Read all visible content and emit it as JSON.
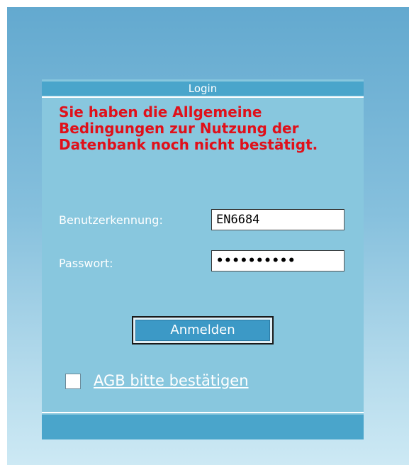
{
  "login": {
    "title": "Login",
    "error_message": "Sie haben die Allgemeine Bedingungen zur Nutzung der Datenbank noch nicht bestätigt.",
    "username_label": "Benutzerkennung:",
    "username_value": "EN6684",
    "password_label": "Passwort:",
    "password_value": "••••••••••",
    "submit_label": "Anmelden",
    "agb_checked": false,
    "agb_link_label": "AGB bitte bestätigen"
  },
  "colors": {
    "background_top": "#63a9cf",
    "background_bottom": "#cde9f4",
    "panel": "#88c7de",
    "header": "#4aa5cb",
    "error": "#e0101a",
    "button": "#3c99c6"
  }
}
